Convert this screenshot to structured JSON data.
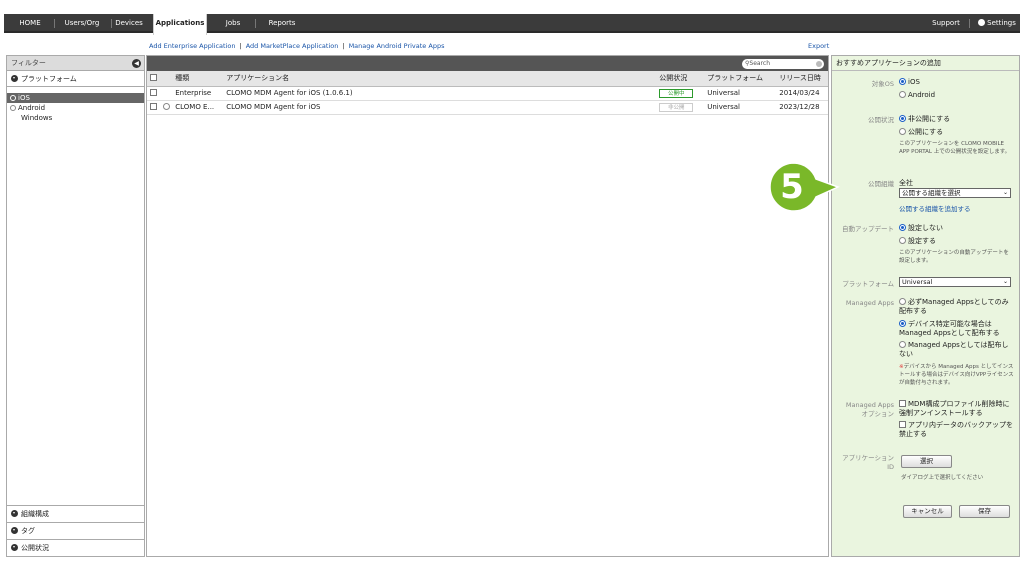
{
  "nav": {
    "tabs": [
      {
        "label": "HOME"
      },
      {
        "label": "Users/Org"
      },
      {
        "label": "Devices"
      },
      {
        "label": "Applications"
      },
      {
        "label": "Jobs"
      },
      {
        "label": "Reports"
      }
    ],
    "active_tab": "Applications",
    "support": "Support",
    "settings": "Settings"
  },
  "links": {
    "add_enterprise": "Add Enterprise Application",
    "add_marketplace": "Add MarketPlace Application",
    "manage_android": "Manage Android Private Apps",
    "separator": "|",
    "export": "Export"
  },
  "filter": {
    "title": "フィルター",
    "platform_section": "プラットフォーム",
    "platforms": [
      "iOS",
      "Android",
      "Windows"
    ],
    "selected_platform": "iOS",
    "bottom_sections": [
      "組織構成",
      "タグ",
      "公開状況"
    ]
  },
  "table": {
    "search_placeholder": "Search",
    "columns": [
      "種類",
      "アプリケーション名",
      "公開状況",
      "プラットフォーム",
      "リリース日時"
    ],
    "rows": [
      {
        "type": "Enterprise",
        "name": "CLOMO MDM Agent for iOS (1.0.6.1)",
        "status": "公開中",
        "platform": "Universal",
        "date": "2014/03/24"
      },
      {
        "type": "CLOMO E...",
        "name": "CLOMO MDM Agent for iOS",
        "status": "非公開",
        "platform": "Universal",
        "date": "2023/12/28"
      }
    ]
  },
  "right": {
    "title": "おすすめアプリケーションの追加",
    "target_os_label": "対象OS",
    "target_os_options": [
      "iOS",
      "Android"
    ],
    "pub_status_label": "公開状況",
    "pub_status_options": [
      "非公開にする",
      "公開にする"
    ],
    "pub_status_note": "このアプリケーションを CLOMO MOBILE APP PORTAL 上での公開状況を設定します。",
    "pub_org_label": "公開組織",
    "pub_org_value": "全社",
    "pub_org_select": "公開する組織を選択",
    "pub_org_add": "公開する組織を追加する",
    "auto_update_label": "自動アップデート",
    "auto_update_options": [
      "設定しない",
      "設定する"
    ],
    "auto_update_note": "このアプリケーションの自動アップデートを設定します。",
    "platform_label": "プラットフォーム",
    "platform_value": "Universal",
    "managed_label": "Managed Apps",
    "managed_options": [
      "必ずManaged Appsとしてのみ配布する",
      "デバイス特定可能な場合は Managed Appsとして配布する",
      "Managed Appsとしては配布しない"
    ],
    "managed_note_mark": "※",
    "managed_note": "デバイスから Managed Apps としてインストールする場合はデバイス向けVPPライセンスが自動付与されます。",
    "managed_opt_label_1": "Managed Apps",
    "managed_opt_label_2": "オプション",
    "managed_opt_options": [
      "MDM構成プロファイル削除時に強制アンインストールする",
      "アプリ内データのバックアップを禁止する"
    ],
    "app_id_label_1": "アプリケーション",
    "app_id_label_2": "ID",
    "select_button": "選択",
    "select_note": "ダイアログ上で選択してください",
    "cancel_button": "キャンセル",
    "save_button": "保存"
  },
  "callout": {
    "number": "5",
    "color": "#7ab829"
  }
}
